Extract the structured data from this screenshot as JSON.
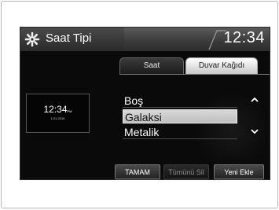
{
  "header": {
    "title": "Saat Tipi",
    "clock": "12:34",
    "settings_icon": "gear-icon"
  },
  "tabs": [
    {
      "label": "Saat",
      "active": false
    },
    {
      "label": "Duvar Kağıdı",
      "active": true
    }
  ],
  "preview": {
    "time": "12:34",
    "meridiem": "PM",
    "date": "1.01.2015"
  },
  "wallpaper_list": {
    "items": [
      "Boş",
      "Galaksi",
      "Metalik"
    ],
    "selected_index": 1,
    "scroll_up_icon": "chevron-up-icon",
    "scroll_down_icon": "chevron-down-icon"
  },
  "buttons": {
    "ok": "TAMAM",
    "delete_all": "Tümünü Sil",
    "add_new": "Yeni Ekle"
  },
  "colors": {
    "screen_background": "#0a0a0a",
    "text": "#ffffff",
    "selected_row": "#c8c8c8",
    "disabled_text": "#888888"
  }
}
